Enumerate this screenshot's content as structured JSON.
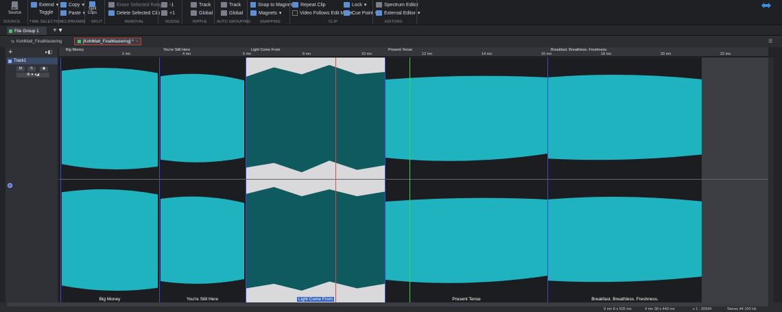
{
  "ribbon": {
    "groups": [
      {
        "name": "SOURCE",
        "items": [
          {
            "label": "Edit\nSource",
            "icon": "edit-source-icon"
          }
        ]
      },
      {
        "name": "TIME SELECTION",
        "items": [
          {
            "label": "Extend",
            "icon": "extend-icon"
          },
          {
            "label": "Toggle",
            "icon": "toggle-icon"
          }
        ]
      },
      {
        "name": "CLIPBOARD",
        "items": [
          {
            "label": "Copy",
            "icon": "copy-icon"
          },
          {
            "label": "Paste",
            "icon": "paste-icon"
          }
        ]
      },
      {
        "name": "SPLIT",
        "items": [
          {
            "label": "Split\nClips",
            "icon": "split-icon"
          }
        ]
      },
      {
        "name": "REMOVAL",
        "items": [
          {
            "label": "Erase Selected Range",
            "icon": "erase-icon",
            "disabled": true
          },
          {
            "label": "Delete Selected Clip",
            "icon": "delete-clip-icon"
          }
        ]
      },
      {
        "name": "NUDGE",
        "items": [
          {
            "label": "-1",
            "icon": "nudge-left-icon"
          },
          {
            "label": "+1",
            "icon": "nudge-right-icon"
          }
        ]
      },
      {
        "name": "RIPPLE",
        "items": [
          {
            "label": "Track",
            "icon": "ripple-track-icon"
          },
          {
            "label": "Global",
            "icon": "ripple-global-icon"
          }
        ]
      },
      {
        "name": "AUTO GROUPING",
        "items": [
          {
            "label": "Track",
            "icon": "group-track-icon"
          },
          {
            "label": "Global",
            "icon": "group-global-icon"
          }
        ]
      },
      {
        "name": "SNAPPING",
        "items": [
          {
            "label": "Snap to Magnets",
            "checked": true
          },
          {
            "label": "Magnets",
            "icon": "magnet-icon"
          }
        ]
      },
      {
        "name": "CLIP",
        "items": [
          {
            "label": "Repeat Clip",
            "icon": "repeat-icon"
          },
          {
            "label": "Video Follows Edit Mode",
            "checked": false
          },
          {
            "label": "Lock",
            "icon": "lock-icon"
          },
          {
            "label": "Cue Point",
            "icon": "cue-point-icon"
          }
        ]
      },
      {
        "name": "EDITORS",
        "items": [
          {
            "label": "Spectrum Editor",
            "icon": "spectrum-icon"
          },
          {
            "label": "External Editor",
            "icon": "external-editor-icon"
          }
        ]
      }
    ]
  },
  "tabs": {
    "file_group": "File Group 1",
    "file_tabs": [
      {
        "label": "KohlMatt_FinalMastering",
        "active": false
      },
      {
        "label": "[KohlMatt_FinalMastering] *",
        "active": true
      }
    ]
  },
  "track": {
    "name": "Track1",
    "buttons": [
      "M",
      "S"
    ]
  },
  "ruler": {
    "ticks": [
      "2 mn",
      "4 mn",
      "6 mn",
      "8 mn",
      "10 mn",
      "12 mn",
      "14 mn",
      "16 mn",
      "18 mn",
      "20 mn",
      "22 mn"
    ]
  },
  "clips": [
    {
      "title": "Big Money",
      "selected": false
    },
    {
      "title": "You're Still Here",
      "selected": false
    },
    {
      "title": "Light Come From",
      "selected": true
    },
    {
      "title": "Present Tense",
      "selected": false
    },
    {
      "title": "Breakfast. Breathless. Freshness.",
      "selected": false
    }
  ],
  "status": {
    "cursor": "9 mn 8 s 535 ms",
    "length": "4 mn 38 s 440 ms",
    "zoom": "x 1 : 30934",
    "format": "Stereo 44 100 Hz"
  },
  "colors": {
    "wave": "#1fb3bf",
    "wave_selected": "#0f5a5f",
    "playhead": "#e2463f",
    "cursor": "#39d64a",
    "marker": "#3b4bd1"
  }
}
